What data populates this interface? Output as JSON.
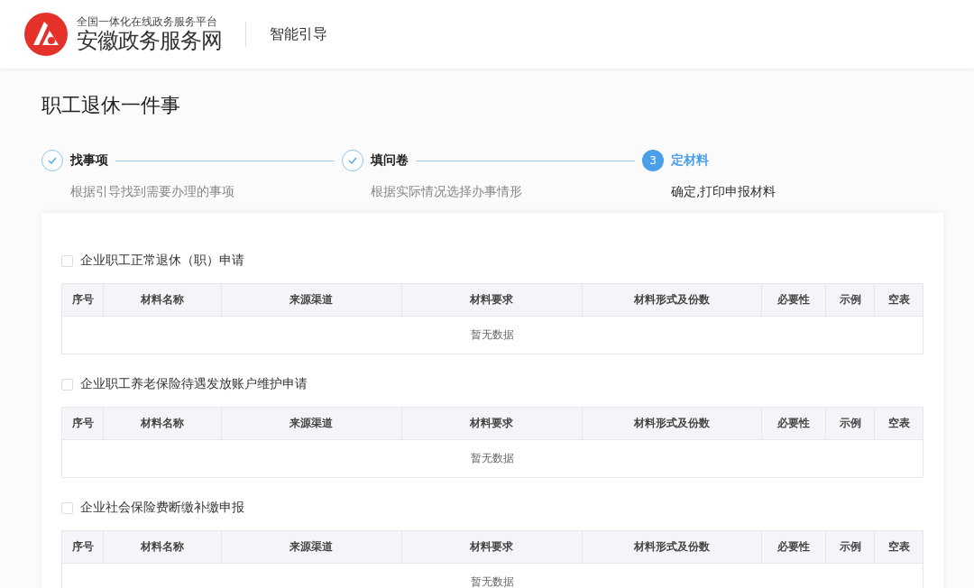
{
  "header": {
    "platform": "全国一体化在线政务服务平台",
    "site_name": "安徽政务服务网",
    "section": "智能引导"
  },
  "page_title": "职工退休一件事",
  "steps": [
    {
      "title": "找事项",
      "description": "根据引导找到需要办理的事项",
      "completed": true,
      "selected": false
    },
    {
      "title": "填问卷",
      "description": "根据实际情况选择办事情形",
      "completed": true,
      "selected": false
    },
    {
      "title": "定材料",
      "description": "确定,打印申报材料",
      "completed": false,
      "selected": true,
      "number": "3"
    }
  ],
  "items": [
    {
      "name": "企业职工正常退休（职）申请",
      "checked": false,
      "columns": [
        "序号",
        "材料名称",
        "来源渠道",
        "材料要求",
        "材料形式及份数",
        "必要性",
        "示例",
        "空表"
      ],
      "empty_text": "暂无数据"
    },
    {
      "name": "企业职工养老保险待遇发放账户维护申请",
      "checked": false,
      "columns": [
        "序号",
        "材料名称",
        "来源渠道",
        "材料要求",
        "材料形式及份数",
        "必要性",
        "示例",
        "空表"
      ],
      "empty_text": "暂无数据"
    },
    {
      "name": "企业社会保险费断缴补缴申报",
      "checked": false,
      "columns": [
        "序号",
        "材料名称",
        "来源渠道",
        "材料要求",
        "材料形式及份数",
        "必要性",
        "示例",
        "空表"
      ],
      "empty_text": "暂无数据"
    }
  ]
}
